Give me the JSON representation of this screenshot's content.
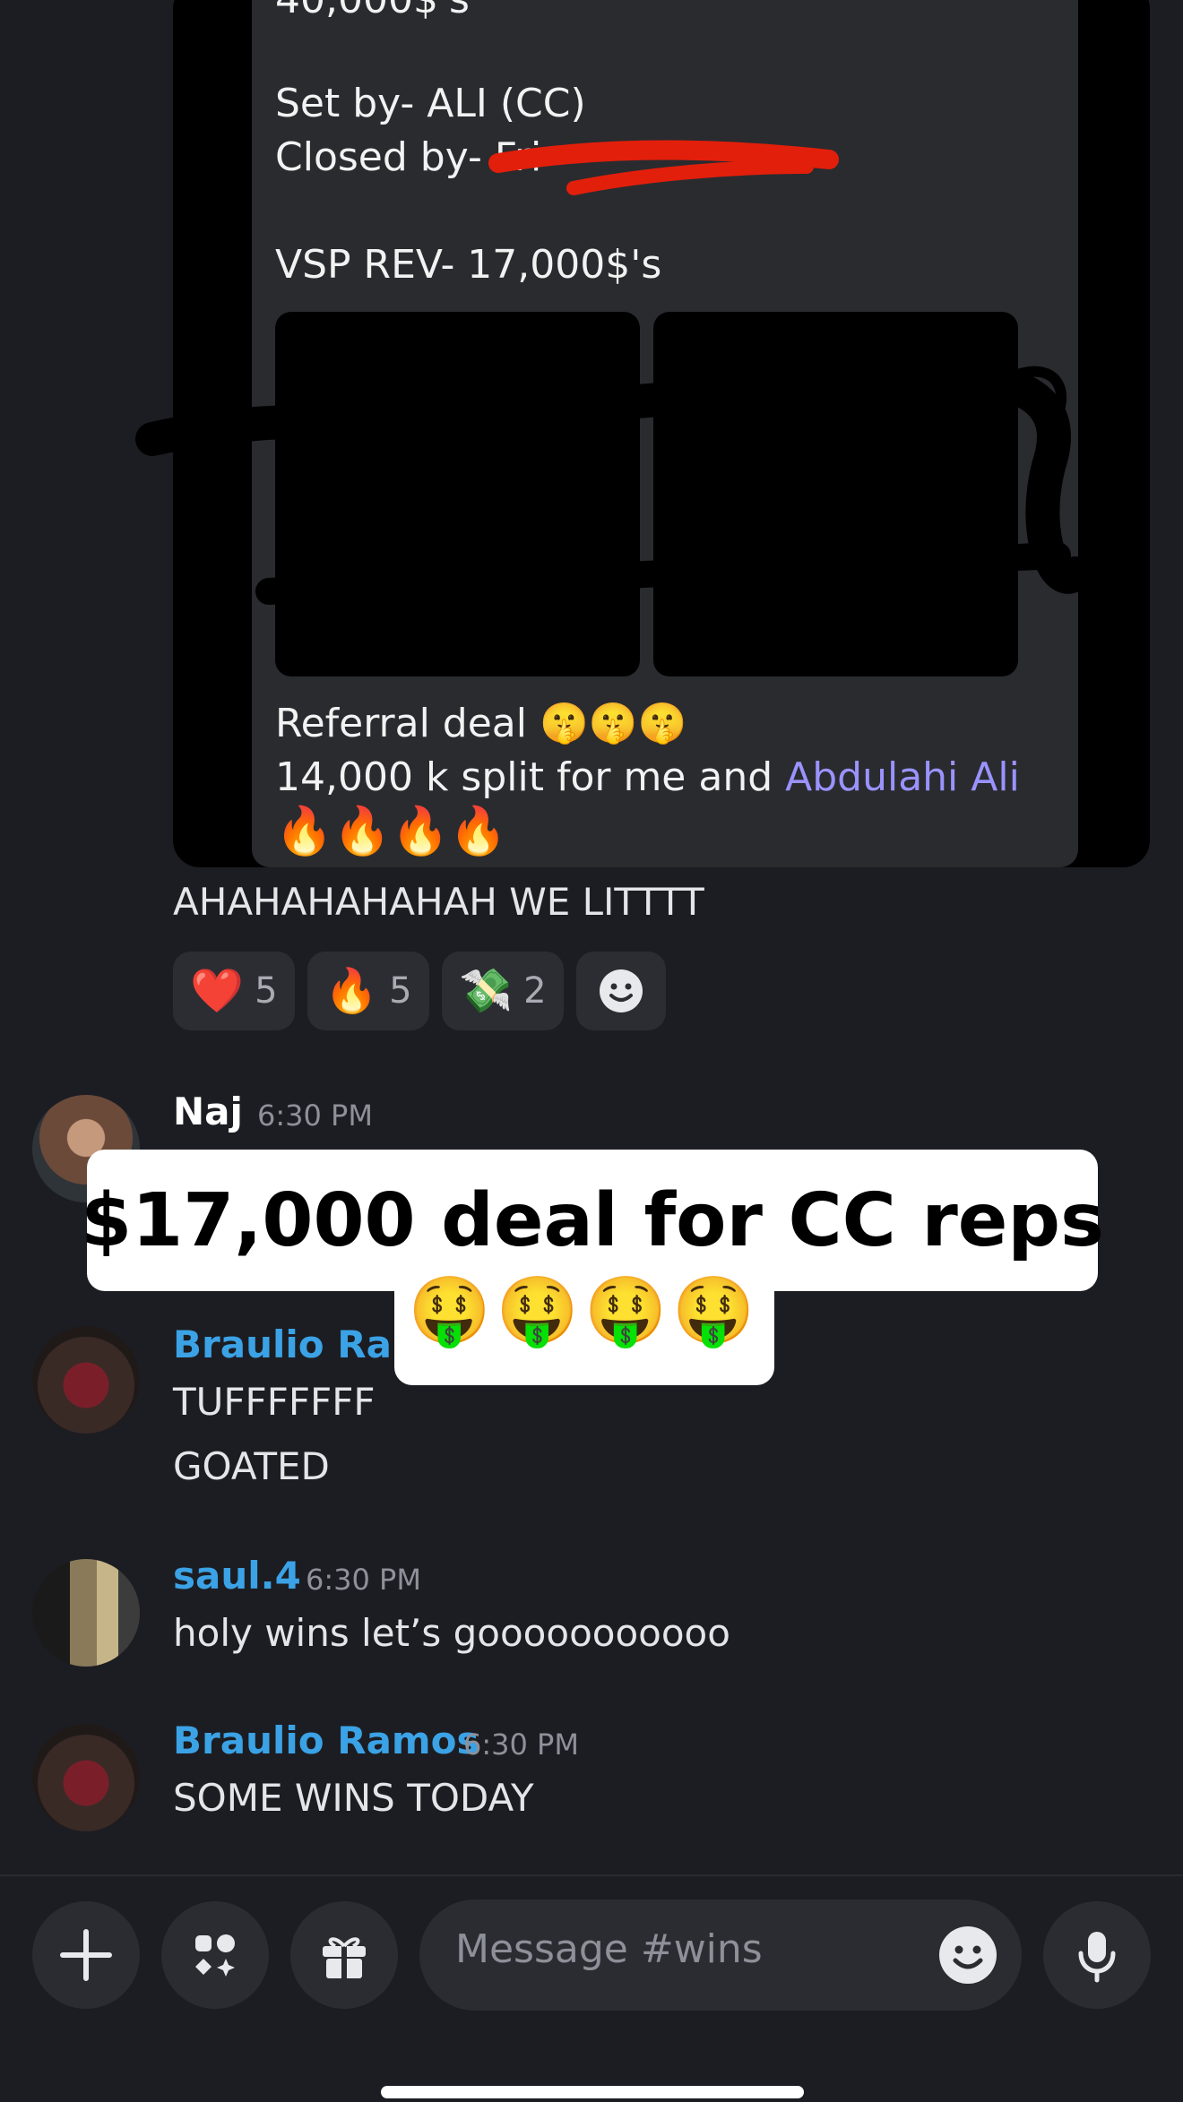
{
  "embed": {
    "line_top": "40,000$'s",
    "set_by": "Set by- ALI (CC)",
    "closed_by": "Closed by- Fri",
    "vsp_rev": "VSP REV- 17,000$'s",
    "referral": "Referral deal 🤫🤫🤫",
    "split_text": "14,000 k split for me and ",
    "mention": "Abdulahi Ali",
    "fire_line": "🔥🔥🔥🔥"
  },
  "top_message_text": "AHAHAHAHAHAH WE LITTTT",
  "reactions": [
    {
      "emoji": "❤️",
      "count": "5"
    },
    {
      "emoji": "🔥",
      "count": "5"
    },
    {
      "emoji": "💸",
      "count": "2"
    },
    {
      "emoji": "add-reaction-icon",
      "count": ""
    }
  ],
  "messages": [
    {
      "user": "Naj",
      "time": "6:30 PM",
      "lines": [],
      "name_color": "#ffffff"
    },
    {
      "user": "Braulio Ram",
      "time": "",
      "lines": [
        "TUFFFFFFF",
        "GOATED"
      ],
      "name_color": "#3ba2e6"
    },
    {
      "user": "saul.4",
      "time": "6:30 PM",
      "lines": [
        "holy wins let’s gooooooooooo"
      ],
      "name_color": "#3ba2e6"
    },
    {
      "user": "Braulio Ramos",
      "time": "6:30 PM",
      "lines": [
        "SOME WINS TODAY"
      ],
      "name_color": "#3ba2e6"
    }
  ],
  "caption": {
    "line1": "$17,000 deal for CC reps",
    "line2": "🤑🤑🤑🤑"
  },
  "composer": {
    "placeholder": "Message #wins",
    "icons": [
      "plus-icon",
      "apps-icon",
      "gift-icon",
      "emoji-icon",
      "microphone-icon"
    ]
  },
  "colors": {
    "background": "#1c1d22",
    "username_blue": "#3ba2e6",
    "mention": "#9a93ff",
    "redaction_red": "#e21f0b"
  }
}
